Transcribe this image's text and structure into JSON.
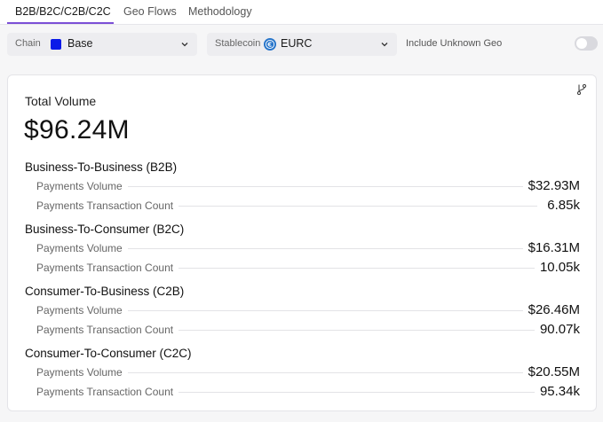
{
  "tabs": [
    {
      "label": "B2B/B2C/C2B/C2C",
      "active": true
    },
    {
      "label": "Geo Flows",
      "active": false
    },
    {
      "label": "Methodology",
      "active": false
    }
  ],
  "filters": {
    "chain": {
      "label": "Chain",
      "value": "Base",
      "swatch_color": "#0a1ae8"
    },
    "stablecoin": {
      "label": "Stablecoin",
      "value": "EURC",
      "icon": "eurc-coin-icon"
    },
    "unknown_geo": {
      "label": "Include Unknown Geo",
      "enabled": false
    }
  },
  "card": {
    "total_label": "Total Volume",
    "total_value": "$96.24M",
    "sections": [
      {
        "title": "Business-To-Business (B2B)",
        "metrics": [
          {
            "label": "Payments Volume",
            "value": "$32.93M"
          },
          {
            "label": "Payments Transaction Count",
            "value": "6.85k"
          }
        ]
      },
      {
        "title": "Business-To-Consumer (B2C)",
        "metrics": [
          {
            "label": "Payments Volume",
            "value": "$16.31M"
          },
          {
            "label": "Payments Transaction Count",
            "value": "10.05k"
          }
        ]
      },
      {
        "title": "Consumer-To-Business (C2B)",
        "metrics": [
          {
            "label": "Payments Volume",
            "value": "$26.46M"
          },
          {
            "label": "Payments Transaction Count",
            "value": "90.07k"
          }
        ]
      },
      {
        "title": "Consumer-To-Consumer (C2C)",
        "metrics": [
          {
            "label": "Payments Volume",
            "value": "$20.55M"
          },
          {
            "label": "Payments Transaction Count",
            "value": "95.34k"
          }
        ]
      }
    ]
  },
  "colors": {
    "accent": "#7b4fd6",
    "chain_swatch": "#0a1ae8",
    "coin_blue": "#2775ca"
  }
}
